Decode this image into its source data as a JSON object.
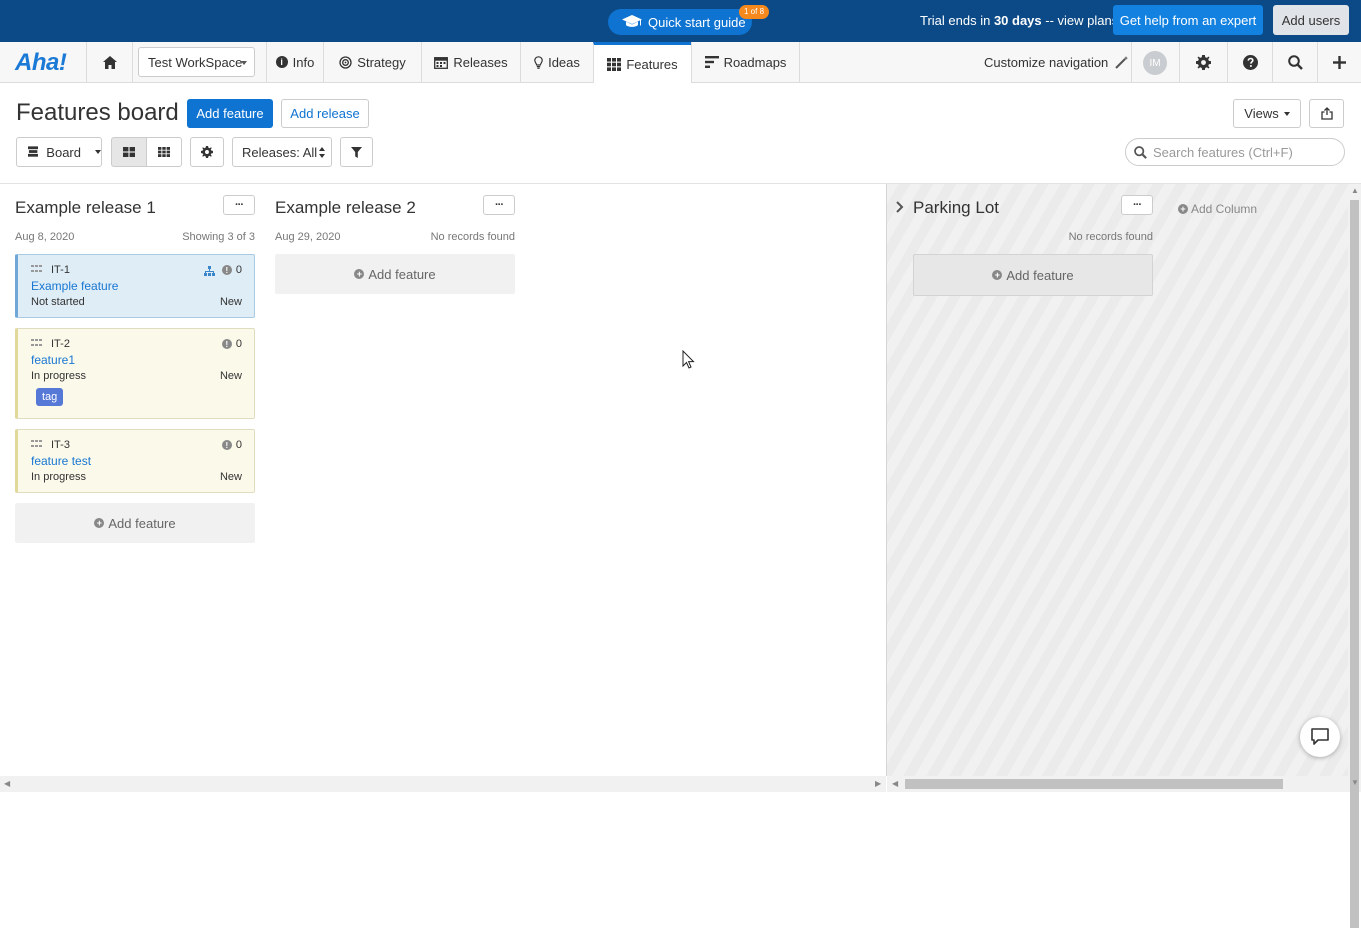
{
  "topbar": {
    "quick_start": "Quick start guide",
    "quick_start_badge": "1 of 8",
    "trial_prefix": "Trial ends in ",
    "trial_days": "30 days",
    "trial_suffix": " -- view plans",
    "help_button": "Get help from an expert",
    "add_users_button": "Add users"
  },
  "nav": {
    "logo": "Aha!",
    "workspace": "Test WorkSpace",
    "items": [
      {
        "label": "Info",
        "icon": "info-icon"
      },
      {
        "label": "Strategy",
        "icon": "target-icon"
      },
      {
        "label": "Releases",
        "icon": "calendar-icon"
      },
      {
        "label": "Ideas",
        "icon": "lightbulb-icon"
      },
      {
        "label": "Features",
        "icon": "grid-icon"
      },
      {
        "label": "Roadmaps",
        "icon": "roadmap-icon"
      }
    ],
    "customize": "Customize navigation",
    "avatar_initials": "IM"
  },
  "header": {
    "title": "Features board",
    "add_feature": "Add feature",
    "add_release": "Add release",
    "views": "Views",
    "board_select": "Board",
    "releases_filter": "Releases: All",
    "search_placeholder": "Search features (Ctrl+F)"
  },
  "columns": [
    {
      "title": "Example release 1",
      "date": "Aug 8, 2020",
      "count": "Showing 3 of 3",
      "cards": [
        {
          "id": "IT-1",
          "title": "Example feature",
          "status": "Not started",
          "workflow": "New",
          "comments": "0"
        },
        {
          "id": "IT-2",
          "title": "feature1",
          "status": "In progress",
          "workflow": "New",
          "comments": "0",
          "tag": "tag"
        },
        {
          "id": "IT-3",
          "title": "feature test",
          "status": "In progress",
          "workflow": "New",
          "comments": "0"
        }
      ],
      "add_feature": "Add feature"
    },
    {
      "title": "Example release 2",
      "date": "Aug 29, 2020",
      "count": "No records found",
      "cards": [],
      "add_feature": "Add feature"
    }
  ],
  "parking_lot": {
    "title": "Parking Lot",
    "count": "No records found",
    "add_feature": "Add feature",
    "add_column": "Add Column"
  },
  "colors": {
    "brand": "#0b4a86",
    "accent": "#0e73d1",
    "badge": "#f5891e",
    "tag": "#5678d6"
  }
}
